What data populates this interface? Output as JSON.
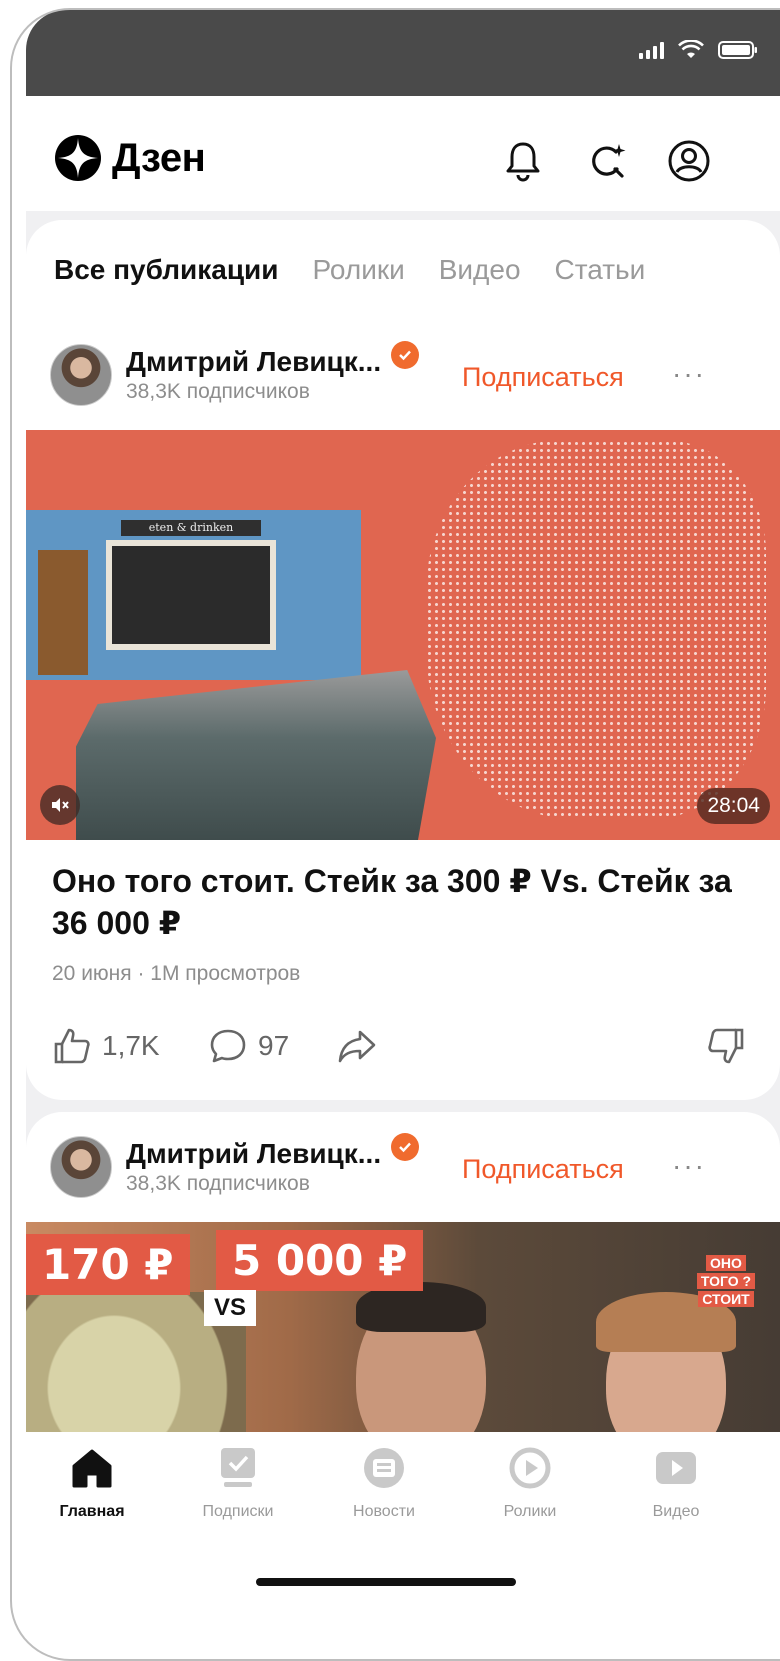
{
  "header": {
    "logo_text": "Дзен"
  },
  "tabs": [
    {
      "label": "Все публикации",
      "active": true
    },
    {
      "label": "Ролики",
      "active": false
    },
    {
      "label": "Видео",
      "active": false
    },
    {
      "label": "Статьи",
      "active": false
    }
  ],
  "posts": [
    {
      "author": "Дмитрий Левицк...",
      "subscribers": "38,3K подписчиков",
      "subscribe_label": "Подписаться",
      "more_label": "···",
      "video_sign": "eten & drinken",
      "duration": "28:04",
      "mute_icon": "mute-icon",
      "title": "Оно того стоит. Стейк за 300 ₽ Vs. Стейк за 36 000 ₽",
      "meta": "20 июня · 1M просмотров",
      "likes": "1,7K",
      "comments": "97"
    },
    {
      "author": "Дмитрий Левицк...",
      "subscribers": "38,3K подписчиков",
      "subscribe_label": "Подписаться",
      "more_label": "···",
      "price_left": "170 ₽",
      "price_right": "5 000 ₽",
      "vs_label": "VS",
      "badge_lines": [
        "ОНО",
        "ТОГО ?",
        "СТОИТ"
      ]
    }
  ],
  "bottom_nav": [
    {
      "label": "Главная",
      "icon": "home-icon",
      "active": true
    },
    {
      "label": "Подписки",
      "icon": "subscriptions-icon",
      "active": false
    },
    {
      "label": "Новости",
      "icon": "news-icon",
      "active": false
    },
    {
      "label": "Ролики",
      "icon": "clips-icon",
      "active": false
    },
    {
      "label": "Видео",
      "icon": "video-icon",
      "active": false
    }
  ],
  "colors": {
    "accent": "#f0582a",
    "verified": "#f06b2e",
    "status_bar": "#4a4a4a"
  }
}
